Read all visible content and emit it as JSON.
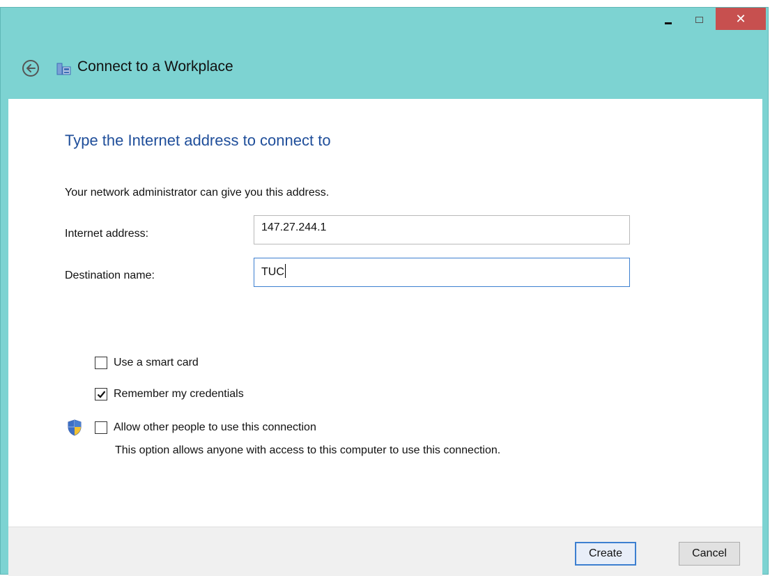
{
  "window": {
    "title": "Connect to a Workplace",
    "controls": {
      "minimize_icon": "minimize-icon",
      "maximize_icon": "maximize-icon",
      "close_label": "✕"
    },
    "accent_color": "#7dd3d2",
    "close_color": "#c7504f"
  },
  "content": {
    "heading": "Type the Internet address to connect to",
    "description": "Your network administrator can give you this address.",
    "fields": {
      "internet_address": {
        "label": "Internet address:",
        "value": "147.27.244.1"
      },
      "destination_name": {
        "label": "Destination name:",
        "value": "TUC"
      }
    },
    "options": {
      "smart_card": {
        "label": "Use a smart card",
        "checked": false
      },
      "remember_credentials": {
        "label": "Remember my credentials",
        "checked": true
      },
      "allow_others": {
        "label": "Allow other people to use this connection",
        "checked": false,
        "note": "This option allows anyone with access to this computer to use this connection."
      }
    }
  },
  "footer": {
    "create_label": "Create",
    "cancel_label": "Cancel"
  }
}
